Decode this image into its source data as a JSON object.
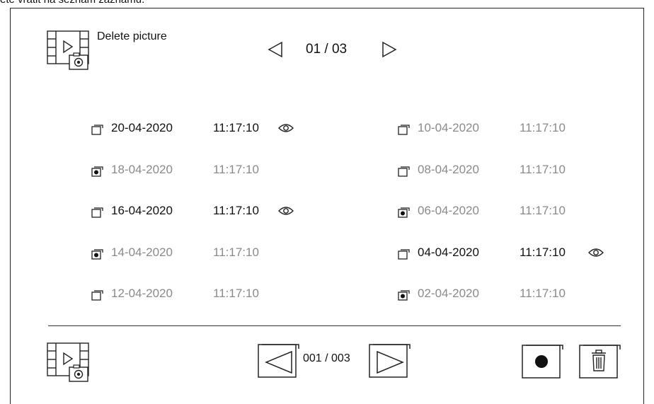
{
  "caption": "ete vrátit na seznam záznamů.",
  "header": {
    "title": "Delete picture",
    "page_indicator": "01 / 03",
    "icon": "video-camera-icon"
  },
  "records": [
    {
      "date": "20-04-2020",
      "time": "11:17:10",
      "checked": false,
      "viewed": true
    },
    {
      "date": "18-04-2020",
      "time": "11:17:10",
      "checked": true,
      "viewed": false
    },
    {
      "date": "16-04-2020",
      "time": "11:17:10",
      "checked": false,
      "viewed": true
    },
    {
      "date": "14-04-2020",
      "time": "11:17:10",
      "checked": true,
      "viewed": false
    },
    {
      "date": "12-04-2020",
      "time": "11:17:10",
      "checked": false,
      "viewed": false
    },
    {
      "date": "10-04-2020",
      "time": "11:17:10",
      "checked": false,
      "viewed": false
    },
    {
      "date": "08-04-2020",
      "time": "11:17:10",
      "checked": false,
      "viewed": false
    },
    {
      "date": "06-04-2020",
      "time": "11:17:10",
      "checked": true,
      "viewed": false
    },
    {
      "date": "04-04-2020",
      "time": "11:17:10",
      "checked": false,
      "viewed": true
    },
    {
      "date": "02-04-2020",
      "time": "11:17:10",
      "checked": true,
      "viewed": false
    }
  ],
  "footer": {
    "page_indicator": "001 / 003",
    "icons": [
      "video-camera-icon",
      "prev-arrow-icon",
      "next-arrow-icon",
      "select-dot-icon",
      "trash-icon"
    ]
  },
  "colors": {
    "line": "#222222",
    "text": "#111111",
    "muted": "#8a8a8a"
  }
}
